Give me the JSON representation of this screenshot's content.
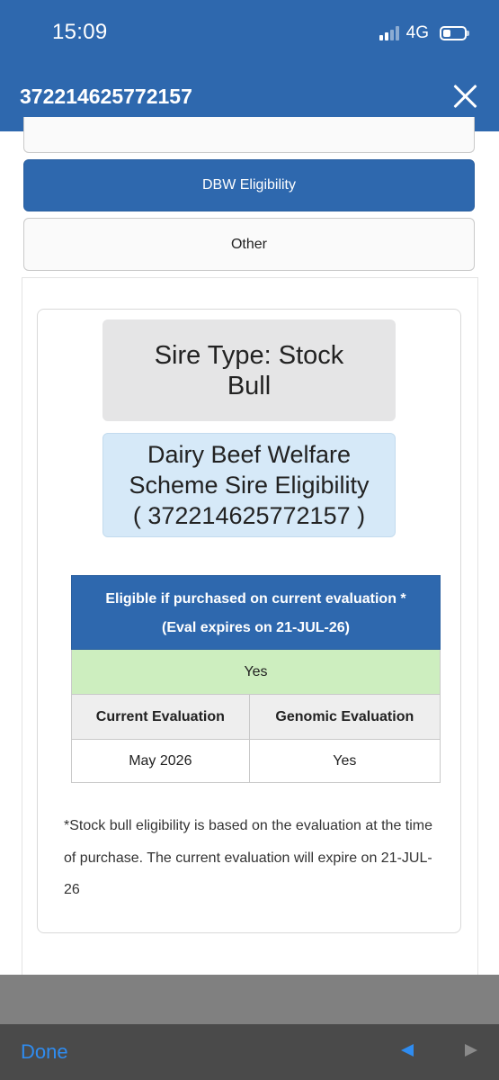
{
  "status_bar": {
    "time": "15:09",
    "network": "4G",
    "signal_bars_active": 2,
    "signal_bars_total": 4,
    "battery_level": 0.35
  },
  "title_bar": {
    "title": "372214625772157",
    "close_icon": "close-icon"
  },
  "menu": {
    "active_label": "DBW Eligibility",
    "other_label": "Other"
  },
  "sire_type": "Sire Type: Stock Bull",
  "dbw": {
    "line1": "Dairy Beef Welfare",
    "line2": "Scheme Sire Eligibility",
    "line3": "( 372214625772157 )"
  },
  "eligibility_table": {
    "header_line1": "Eligible if purchased on current evaluation *",
    "header_line2": "(Eval expires on 21-JUL-26)",
    "result": "Yes",
    "columns": [
      "Current Evaluation",
      "Genomic Evaluation"
    ],
    "values": [
      "May 2026",
      "Yes"
    ]
  },
  "footnote": "*Stock bull eligibility is based on the evaluation at the time of purchase. The current evaluation will expire on 21-JUL-26",
  "toolbar": {
    "done_label": "Done",
    "prev_icon": "back-arrow-icon",
    "next_icon": "forward-arrow-icon"
  },
  "colors": {
    "header_blue": "#2e68ae",
    "eligible_green": "#cdeebf",
    "info_blue": "#d6e9f8",
    "link_blue": "#2f8cf0"
  }
}
